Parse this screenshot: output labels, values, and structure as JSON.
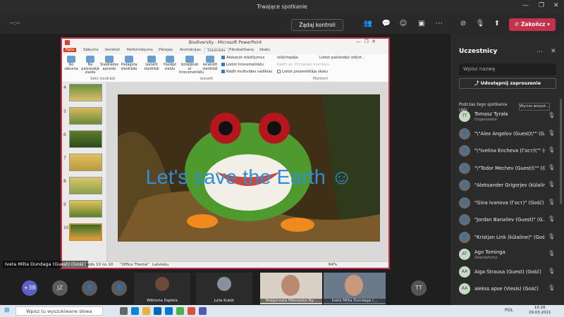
{
  "window": {
    "title": "Trwające spotkanie",
    "controls": [
      "—",
      "❐",
      "✕"
    ]
  },
  "toolbar": {
    "timer": "--:--",
    "control_label": "Żądaj kontroli",
    "end_label": "Zakończ"
  },
  "ppt": {
    "title": "Biodiversity - Microsoft PowerPoint",
    "tabs": [
      "Fails",
      "Sākums",
      "Ievietot",
      "Noformējums",
      "Pārejas",
      "Animācijas",
      "Slaidrāde",
      "Pārskatīšana",
      "Skats"
    ],
    "ribbon": {
      "buttons": [
        "No sākuma",
        "No pašreizējā slaida",
        "Slaidrādes apraide",
        "Pielāgota slaidrāde",
        "Iestatīt slaidrādi",
        "Paslēpt slaidu",
        "Izmēģināt ar hronometrāžu",
        "Ierakstīt slaidrādi"
      ],
      "groups": [
        "Sākt slaidrādi",
        "Iestatīt",
        "Monitori"
      ],
      "checks": [
        "Atskaņot stāstījumus",
        "Lietot hronometrāžu",
        "Rādīt multivides vadīklas"
      ],
      "monitor": [
        "Izšķirtspēja:",
        "Lietot pašreizējo izšķirt...",
        "Rādīt uz:",
        "Primārais monitors",
        "Lietot prezentētāja skatu"
      ]
    },
    "slide_numbers": [
      "4",
      "5",
      "6",
      "7",
      "8",
      "9",
      "10"
    ],
    "slide_text": "Let's save the Earth ☺",
    "status": {
      "slide": "Slaids 10 no 10",
      "theme": "\"Office Theme\"",
      "lang": "Latviešu",
      "zoom": "64%"
    }
  },
  "presenter_label": "Iveta Milta Dundaga (Guest) (Gość)",
  "strip": {
    "more": "+38",
    "avatars": [
      "JZ",
      "",
      ""
    ],
    "tiles": [
      "Wiktoria Dądela",
      "Julia Kubik",
      "Małgorzata Mikowska-Ny...",
      "Iveta Milta Dundaga (...",
      "TT"
    ]
  },
  "panel": {
    "title": "Uczestnicy",
    "search_placeholder": "Wpisz nazwę",
    "share": "Udostępnij zaproszenie",
    "section": "Podczas tego spotkania",
    "count": "(46)",
    "mute_all": "Wycisz wszyst...",
    "people": [
      {
        "initials": "TT",
        "name": "Tomasz Tyrała",
        "sub": "Organizator"
      },
      {
        "initials": "",
        "name": "\"\\\"Alex Angelov (Guest)\\\"\" (G...",
        "sub": ""
      },
      {
        "initials": "",
        "name": "\"\\\"Ivelina Encheva (Гост)\\\"\" (G...",
        "sub": ""
      },
      {
        "initials": "",
        "name": "\"\\\"Todor Mechev (Guest)\\\"\" (G...",
        "sub": ""
      },
      {
        "initials": "",
        "name": "\"Aleksander Grigorjev (külalin...",
        "sub": ""
      },
      {
        "initials": "",
        "name": "\"Gina Ivanova (Гост)\" (Gość)",
        "sub": ""
      },
      {
        "initials": "",
        "name": "\"Jordan Banaliev (Guest)\" (G...",
        "sub": ""
      },
      {
        "initials": "",
        "name": "\"Kristjan Link (külaline)\" (Gość)",
        "sub": ""
      },
      {
        "initials": "AT",
        "name": "Ago Tominga",
        "sub": "Zewnętrzny"
      },
      {
        "initials": "AA",
        "name": "Aiga Štrausa (Guest) (Gość)",
        "sub": ""
      },
      {
        "initials": "AA",
        "name": "alekss apse (Viesis) (Gość)",
        "sub": ""
      }
    ]
  },
  "taskbar": {
    "search": "Wpisz tu wyszukiwane słowa",
    "lang": "POL",
    "time": "10:26",
    "date": "29.03.2021"
  },
  "colors": {
    "end": "#c4314b",
    "bg": "#1f1f1f",
    "panel": "#2b2b2b",
    "slide_text": "#2f8fd8"
  }
}
